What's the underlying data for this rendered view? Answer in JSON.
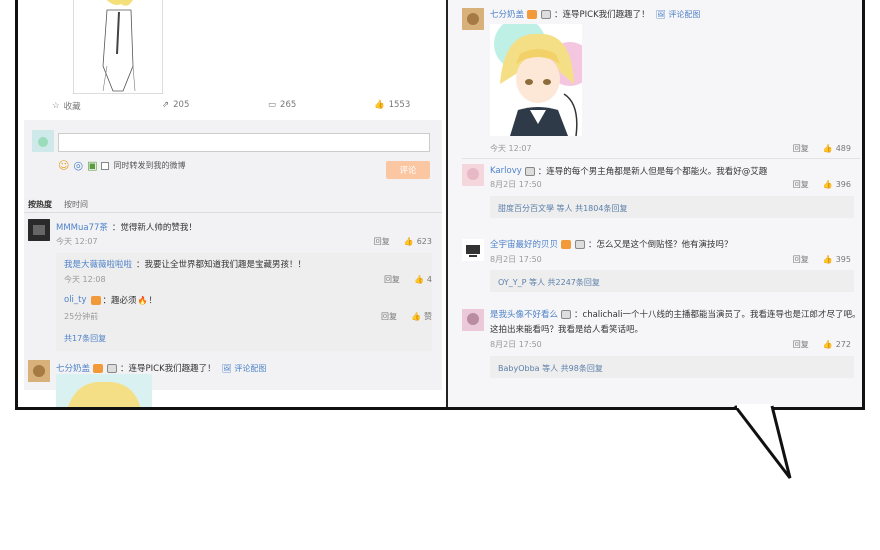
{
  "left": {
    "stats": {
      "favorite": "收藏",
      "repost": "205",
      "comment": "265",
      "like": "1553"
    },
    "composer": {
      "placeholder": "",
      "repost_check": "同时转发到我的微博",
      "submit": "评论"
    },
    "sort": {
      "hot": "按热度",
      "time": "按时间"
    },
    "comments": [
      {
        "name": "MMMua77茶",
        "text": "：觉得新人帅的赞我！",
        "time": "今天 12:07",
        "reply": "回复",
        "likes": "623",
        "replies": [
          {
            "name": "我是大薇薇啦啦啦",
            "text": "：我要让全世界都知道我们趣是宝藏男孩！！",
            "time": "今天 12:08",
            "reply": "回复",
            "likes": "4"
          },
          {
            "name": "oli_ty",
            "text": "：趣必须",
            "text2": "！",
            "time": "25分钟前",
            "reply": "回复",
            "likes": "赞"
          }
        ],
        "more": "共17条回复"
      },
      {
        "name": "七分奶盖",
        "text": "：连导PICK我们趣趣了！",
        "pic_label": "评论配图"
      }
    ]
  },
  "right": {
    "comments": [
      {
        "name": "七分奶盖",
        "text": "：连导PICK我们趣趣了！",
        "pic_label": "评论配图",
        "time": "今天 12:07",
        "reply": "回复",
        "likes": "489"
      },
      {
        "name": "Karlovy",
        "text": "：连导的每个男主角都是新人但是每个都能火。我看好@艾趣",
        "time": "8月2日 17:50",
        "reply": "回复",
        "likes": "396",
        "summary": "甜度百分百文學 等人 共1804条回复"
      },
      {
        "name": "全宇宙最好的贝贝",
        "text": "：怎么又是这个倒贴怪？他有演技吗？",
        "time": "8月2日 17:50",
        "reply": "回复",
        "likes": "395",
        "summary": "OY_Y_P 等人 共2247条回复"
      },
      {
        "name": "是我头像不好看么",
        "text": "：chalichali一个十八线的主播都能当演员了。我看连导也是江郎才尽了吧。",
        "text_line2": "这拍出来能看吗？我看是给人看笑话吧。",
        "time": "8月2日 17:50",
        "reply": "回复",
        "likes": "272",
        "summary": "BabyObba 等人 共98条回复"
      }
    ]
  }
}
